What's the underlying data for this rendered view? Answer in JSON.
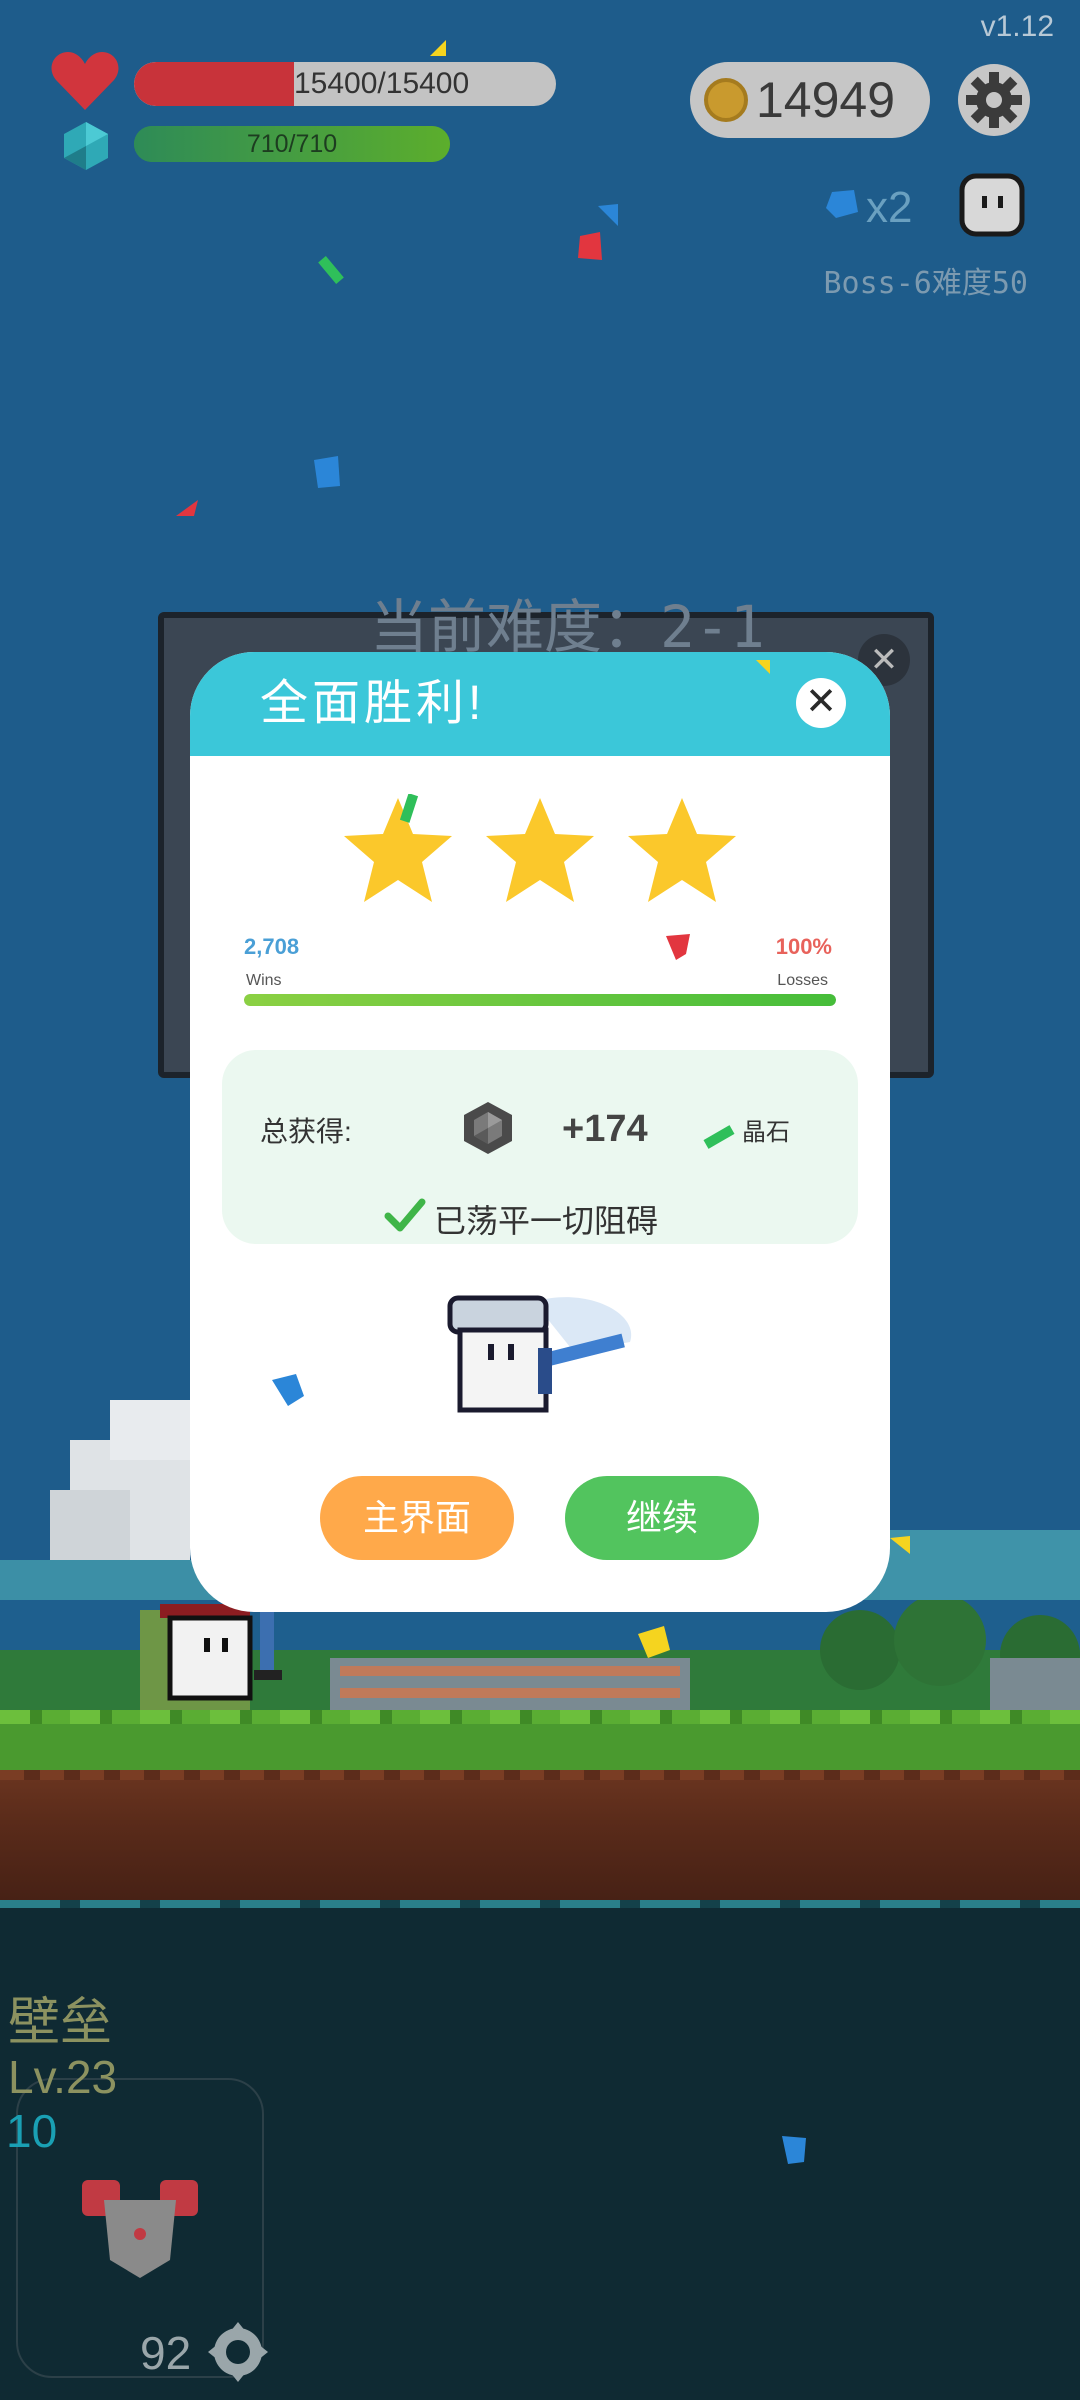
{
  "hud": {
    "version": "v1.12",
    "hp_text": "15400/15400",
    "hp_fraction": 0.38,
    "mp_text": "710/710",
    "mp_fraction": 1.0,
    "coins": "14949",
    "crystal_count": "x2",
    "boss_label": "Boss-6难度50"
  },
  "background_dialog": {
    "title": "当前难度：2-1"
  },
  "modal": {
    "title": "全面胜利!",
    "stars": 3,
    "wins_count": "2,708",
    "wins_label": "Wins",
    "losses_value": "100%",
    "losses_label": "Losses",
    "win_fraction": 1.0,
    "reward_label": "总获得:",
    "reward_amount": "+174",
    "reward_unit": "晶石",
    "cleared_text": "已荡平一切阻碍",
    "main_button": "主界面",
    "continue_button": "继续"
  },
  "skill_card": {
    "name": "壁垒",
    "level": "Lv.23",
    "value": "10",
    "cost": "92"
  },
  "colors": {
    "header_cyan": "#3bc7d9",
    "main_button": "#ffa94a",
    "continue_button": "#52c45e",
    "star": "#fbc82b"
  }
}
